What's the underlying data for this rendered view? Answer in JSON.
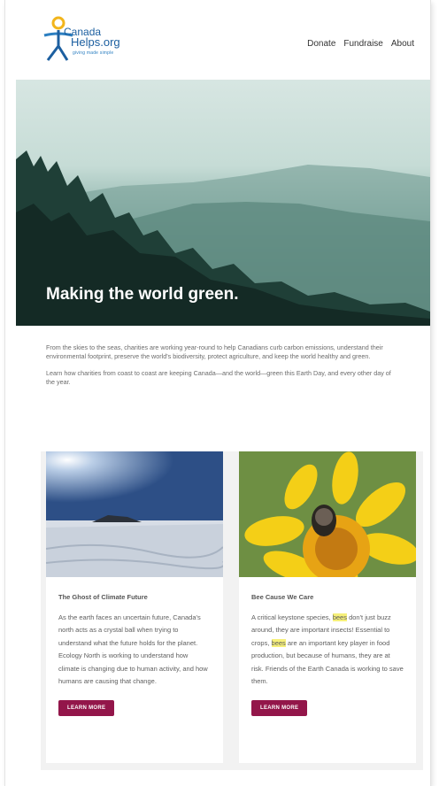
{
  "header": {
    "logo": {
      "line1": "Canada",
      "line2": "Helps.org",
      "tagline": "giving made simple"
    },
    "nav": [
      "Donate",
      "Fundraise",
      "About"
    ]
  },
  "hero": {
    "title": "Making the world green."
  },
  "intro": {
    "p1": "From the skies to the seas, charities are working year-round to help Canadians curb carbon emissions, understand their environmental footprint, preserve the world's biodiversity, protect agriculture, and keep the world healthy and green.",
    "p2": "Learn how charities from coast to coast are keeping Canada—and the world—green this Earth Day, and every other day of the year."
  },
  "cards": [
    {
      "title": "The Ghost of Climate Future",
      "text": "As the earth faces an uncertain future, Canada's north acts as a crystal ball when trying to understand what the future holds for the planet. Ecology North is working to understand how climate is changing due to human activity, and how humans are causing that change.",
      "button": "LEARN MORE"
    },
    {
      "title": "Bee Cause We Care",
      "text_a": "A critical keystone species,",
      "hl1": "bees",
      "text_b": "don't just buzz around, they are important insects! Essential to crops,",
      "hl2": "bees",
      "text_c": "are an important key player in food production, but because of humans, they are at risk. Friends of the Earth Canada is working to save them.",
      "button": "LEARN MORE"
    }
  ],
  "colors": {
    "button": "#93164a",
    "highlight": "#f6f07a",
    "logo_blue": "#1c5fa0",
    "logo_yellow": "#f2b51c"
  }
}
